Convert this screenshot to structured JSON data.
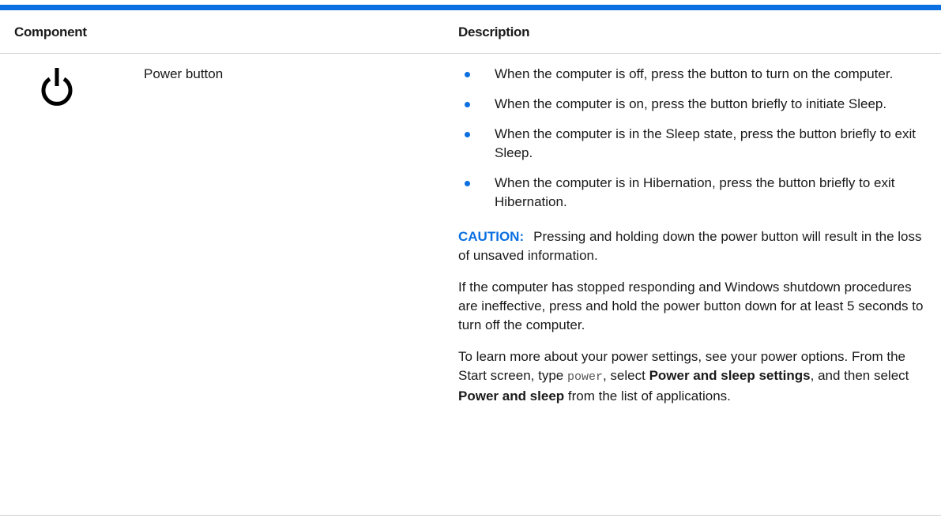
{
  "table": {
    "header": {
      "component": "Component",
      "description": "Description"
    },
    "row": {
      "icon": "power-icon",
      "component_name": "Power button",
      "bullets": [
        "When the computer is off, press the button to turn on the computer.",
        "When the computer is on, press the button briefly to initiate Sleep.",
        "When the computer is in the Sleep state, press the button briefly to exit Sleep.",
        "When the computer is in Hibernation, press the button briefly to exit Hibernation."
      ],
      "caution": {
        "label": "CAUTION:",
        "text": "Pressing and holding down the power button will result in the loss of unsaved information."
      },
      "para_unresponsive": "If the computer has stopped responding and Windows shutdown procedures are ineffective, press and hold the power button down for at least 5 seconds to turn off the computer.",
      "para_settings": {
        "part1": "To learn more about your power settings, see your power options. From the Start screen, type ",
        "code": "power",
        "part2": ", select ",
        "bold1": "Power and sleep settings",
        "part3": ", and then select ",
        "bold2": "Power and sleep",
        "part4": " from the list of applications."
      }
    }
  },
  "colors": {
    "accent": "#0a6fe0",
    "text": "#1a1a1a",
    "rule": "#cfcfcf"
  }
}
